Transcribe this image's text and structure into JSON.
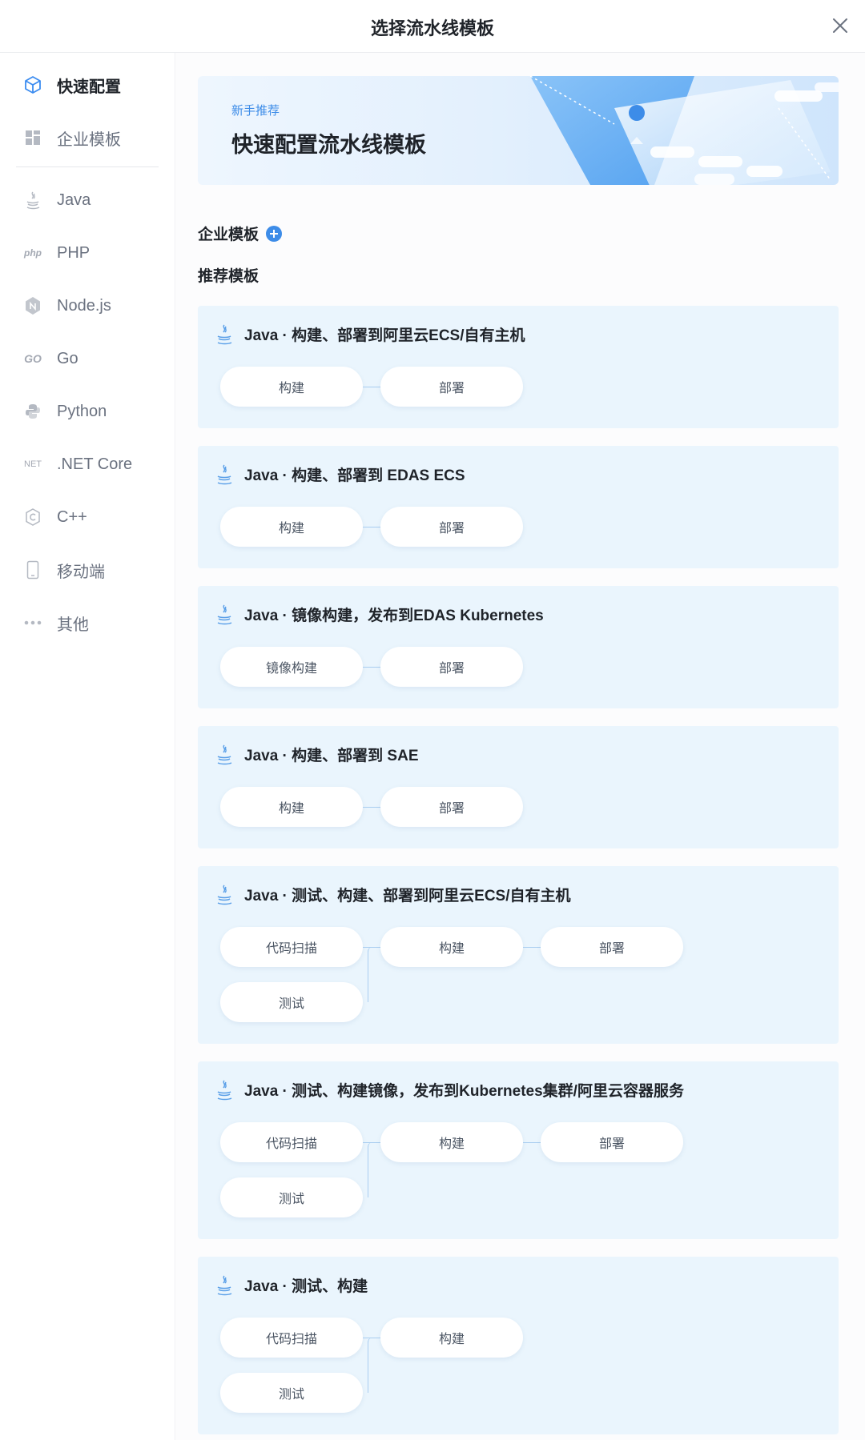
{
  "header": {
    "title": "选择流水线模板"
  },
  "sidebar": {
    "items": [
      {
        "label": "快速配置",
        "icon": "cube-icon",
        "active": true
      },
      {
        "label": "企业模板",
        "icon": "grid-icon"
      },
      {
        "label": "Java",
        "icon": "java-icon"
      },
      {
        "label": "PHP",
        "icon": "php-icon",
        "icon_text": "php"
      },
      {
        "label": "Node.js",
        "icon": "nodejs-icon"
      },
      {
        "label": "Go",
        "icon": "go-icon",
        "icon_text": "GO"
      },
      {
        "label": "Python",
        "icon": "python-icon"
      },
      {
        "label": ".NET Core",
        "icon": "dotnet-icon",
        "icon_text": "NET"
      },
      {
        "label": "C++",
        "icon": "cpp-icon"
      },
      {
        "label": "移动端",
        "icon": "mobile-icon"
      },
      {
        "label": "其他",
        "icon": "more-icon"
      }
    ]
  },
  "banner": {
    "subtitle": "新手推荐",
    "title": "快速配置流水线模板"
  },
  "sections": {
    "enterprise": "企业模板",
    "recommended": "推荐模板"
  },
  "templates": [
    {
      "title": "Java · 构建、部署到阿里云ECS/自有主机",
      "stages": [
        "构建",
        "部署"
      ]
    },
    {
      "title": "Java · 构建、部署到 EDAS ECS",
      "stages": [
        "构建",
        "部署"
      ]
    },
    {
      "title": "Java · 镜像构建，发布到EDAS Kubernetes",
      "stages": [
        "镜像构建",
        "部署"
      ]
    },
    {
      "title": "Java · 构建、部署到 SAE",
      "stages": [
        "构建",
        "部署"
      ]
    },
    {
      "title": "Java · 测试、构建、部署到阿里云ECS/自有主机",
      "stages": [
        "代码扫描",
        "测试",
        "构建",
        "部署"
      ]
    },
    {
      "title": "Java · 测试、构建镜像，发布到Kubernetes集群/阿里云容器服务",
      "stages": [
        "代码扫描",
        "测试",
        "构建",
        "部署"
      ]
    },
    {
      "title": "Java · 测试、构建",
      "stages": [
        "代码扫描",
        "测试",
        "构建"
      ]
    }
  ],
  "colors": {
    "accent": "#3d8ce8",
    "card_bg": "#eaf5fd",
    "active_icon": "#3b8cf0"
  }
}
